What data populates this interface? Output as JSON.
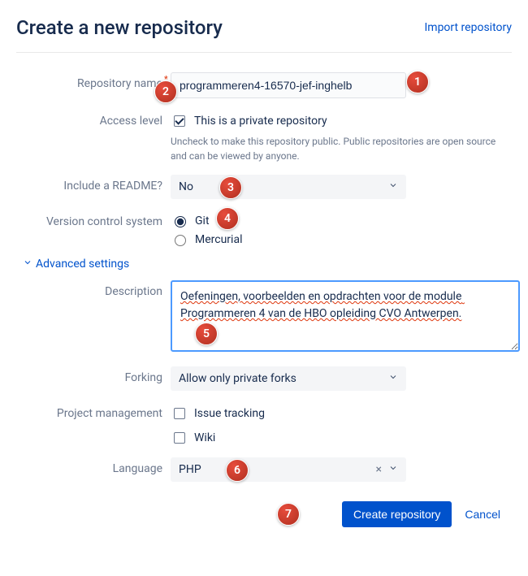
{
  "header": {
    "title": "Create a new repository",
    "import_link": "Import repository"
  },
  "form": {
    "name": {
      "label": "Repository name",
      "value": "programmeren4-16570-jef-inghelb"
    },
    "access": {
      "label": "Access level",
      "checkbox_label": "This is a private repository",
      "checked": true,
      "helper": "Uncheck to make this repository public. Public repositories are open source and can be viewed by anyone."
    },
    "readme": {
      "label": "Include a README?",
      "value": "No"
    },
    "vcs": {
      "label": "Version control system",
      "git": "Git",
      "mercurial": "Mercurial"
    },
    "advanced": {
      "toggle": "Advanced settings"
    },
    "description": {
      "label": "Description",
      "value": "Oefeningen, voorbeelden en opdrachten voor de module Programmeren 4 van de HBO opleiding CVO Antwerpen."
    },
    "forking": {
      "label": "Forking",
      "value": "Allow only private forks"
    },
    "pm": {
      "label": "Project management",
      "issue": "Issue tracking",
      "wiki": "Wiki"
    },
    "language": {
      "label": "Language",
      "value": "PHP"
    }
  },
  "buttons": {
    "create": "Create repository",
    "cancel": "Cancel"
  },
  "badges": {
    "b1": "1",
    "b2": "2",
    "b3": "3",
    "b4": "4",
    "b5": "5",
    "b6": "6",
    "b7": "7"
  }
}
